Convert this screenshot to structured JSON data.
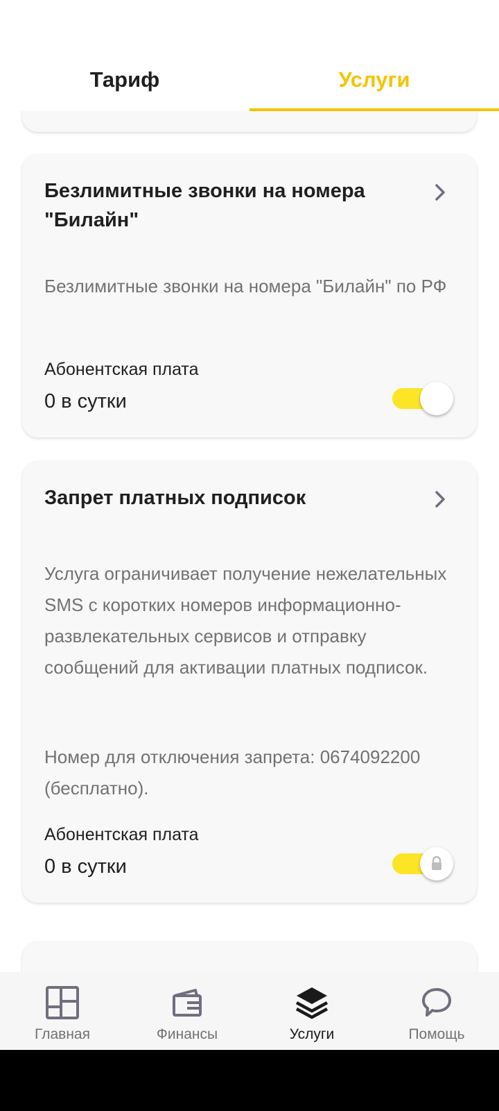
{
  "tabs": {
    "tariff": "Тариф",
    "services": "Услуги"
  },
  "cards": [
    {
      "title": "Безлимитные звонки на номера \"Билайн\"",
      "description": "Безлимитные звонки на номера \"Билайн\" по РФ",
      "fee_label": "Абонентская плата",
      "fee_value": "0 в сутки",
      "toggle": {
        "on": true,
        "locked": false
      }
    },
    {
      "title": "Запрет платных подписок",
      "description": "Услуга ограничивает получение нежелательных SMS с коротких номеров информационно-развлекательных сервисов и отправку сообщений для активации платных подписок.",
      "note": "Номер для отключения запрета: 0674092200 (бесплатно).",
      "fee_label": "Абонентская плата",
      "fee_value": "0 в сутки",
      "toggle": {
        "on": true,
        "locked": true
      }
    }
  ],
  "nav": {
    "home": "Главная",
    "finance": "Финансы",
    "services": "Услуги",
    "help": "Помощь"
  },
  "colors": {
    "accent": "#f5c400",
    "toggle_track": "#fce527",
    "card_bg": "#f8f8f8",
    "muted_text": "#727272"
  },
  "icons": {
    "chevron": "chevron-right-icon",
    "home": "dashboard-grid-icon",
    "finance": "wallet-icon",
    "services": "layers-icon",
    "help": "speech-bubble-icon",
    "lock": "lock-icon"
  }
}
